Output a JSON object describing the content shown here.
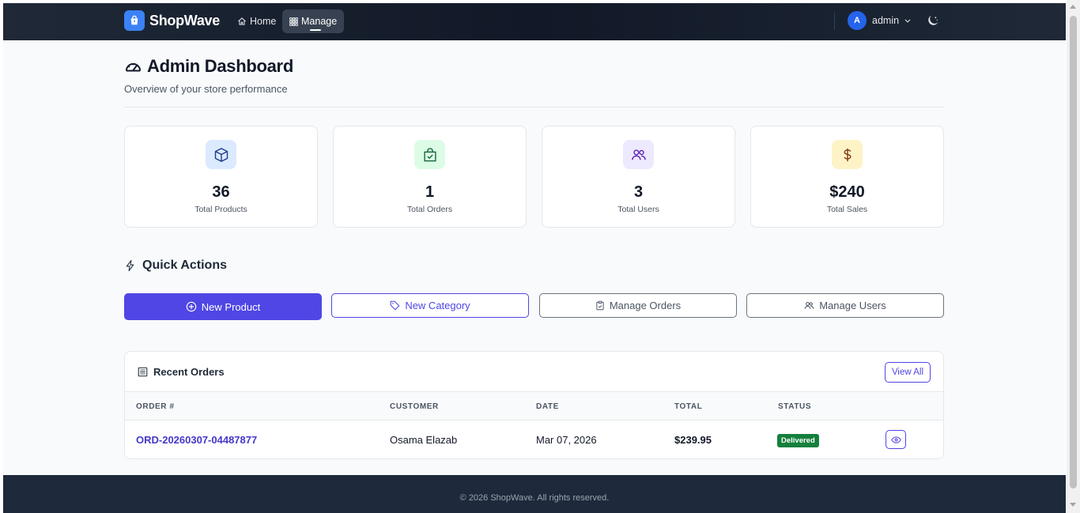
{
  "navbar": {
    "brand": "ShopWave",
    "links": [
      {
        "label": "Home",
        "icon": "home-icon"
      },
      {
        "label": "Manage",
        "icon": "grid-icon",
        "active": true
      }
    ],
    "user": {
      "avatar_letter": "A",
      "name": "admin"
    },
    "theme_icon": "moon-icon"
  },
  "header": {
    "title": "Admin Dashboard",
    "subtitle": "Overview of your store performance"
  },
  "stats": [
    {
      "value": "36",
      "label": "Total Products",
      "icon": "box-icon",
      "color": "#2563eb",
      "bg": "#dbeafe"
    },
    {
      "value": "1",
      "label": "Total Orders",
      "icon": "bag-check-icon",
      "color": "#16a34a",
      "bg": "#dcfce7"
    },
    {
      "value": "3",
      "label": "Total Users",
      "icon": "users-icon",
      "color": "#7c3aed",
      "bg": "#ede9fe"
    },
    {
      "value": "$240",
      "label": "Total Sales",
      "icon": "dollar-icon",
      "color": "#b45309",
      "bg": "#fef3c7"
    }
  ],
  "quick_actions": {
    "title": "Quick Actions",
    "buttons": [
      {
        "label": "New Product",
        "icon": "plus-circle-icon",
        "style": "primary"
      },
      {
        "label": "New Category",
        "icon": "tag-icon",
        "style": "indigo"
      },
      {
        "label": "Manage Orders",
        "icon": "clipboard-icon",
        "style": "gray"
      },
      {
        "label": "Manage Users",
        "icon": "users-icon",
        "style": "gray"
      }
    ]
  },
  "recent_orders": {
    "title": "Recent Orders",
    "view_all": "View All",
    "columns": [
      "ORDER #",
      "CUSTOMER",
      "DATE",
      "TOTAL",
      "STATUS"
    ],
    "rows": [
      {
        "order": "ORD-20260307-04487877",
        "customer": "Osama Elazab",
        "date": "Mar 07, 2026",
        "total": "$239.95",
        "status": "Delivered"
      }
    ]
  },
  "footer": {
    "text": "© 2026 ShopWave. All rights reserved."
  },
  "colors": {
    "accent": "#4f46e5",
    "brand": "#3b82f6",
    "success": "#15803d",
    "navbar": "#111827"
  }
}
